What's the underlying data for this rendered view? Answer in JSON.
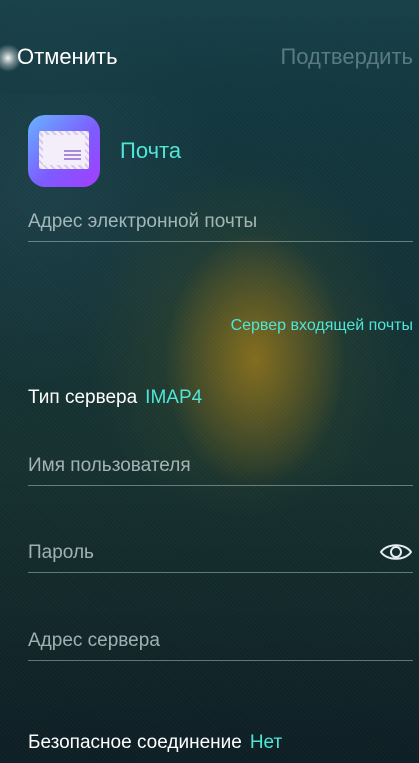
{
  "header": {
    "cancel_label": "Отменить",
    "confirm_label": "Подтвердить"
  },
  "account": {
    "icon": "mail-app-icon",
    "name": "Почта"
  },
  "form": {
    "email_placeholder": "Адрес электронной почты",
    "incoming_section_label": "Сервер входящей почты",
    "server_type_label": "Тип сервера",
    "server_type_value": "IMAP4",
    "username_placeholder": "Имя пользователя",
    "password_placeholder": "Пароль",
    "server_address_placeholder": "Адрес сервера",
    "secure_connection_label": "Безопасное соединение",
    "secure_connection_value": "Нет"
  },
  "colors": {
    "accent": "#4fe6d8",
    "confirm_disabled": "#b4d2d7"
  }
}
